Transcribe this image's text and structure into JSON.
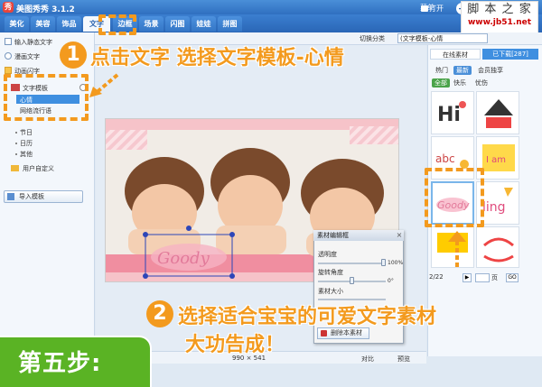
{
  "app": {
    "title": "美图秀秀 3.1.2",
    "logo_text": "秀"
  },
  "title_menu": "菜单",
  "tabs": [
    "美化",
    "美容",
    "饰品",
    "文字",
    "边框",
    "场景",
    "闪图",
    "娃娃",
    "拼图"
  ],
  "active_tab": "文字",
  "topbar": {
    "open_label": "打开"
  },
  "watermark": {
    "text": "脚 本 之 家",
    "url": "www.jb51.net"
  },
  "toolbar": {
    "category_label": "切换分类",
    "category_value": "(文字模板-心情"
  },
  "left_panel": {
    "items": [
      {
        "label": "输入静态文字"
      },
      {
        "label": "漫画文字"
      },
      {
        "label": "动画闪字"
      }
    ],
    "templates": {
      "header": "文字模板",
      "subs": [
        "心情",
        "网络流行语"
      ],
      "more": [
        "节日",
        "日历",
        "其他"
      ],
      "custom": "用户自定义"
    },
    "import_label": "导入模板"
  },
  "right_panel": {
    "tabs": [
      "在线素材",
      "已下载[287]"
    ],
    "pills": [
      "热门",
      "最新",
      "会员独享"
    ],
    "sub_tabs": [
      "全部",
      "快乐",
      "忧伤"
    ],
    "pager": {
      "current": "2/22",
      "of_label": "页",
      "go": "GO"
    },
    "footer": [
      "刷新",
      "下载本页",
      "素材"
    ]
  },
  "canvas": {
    "dims": "990 × 541",
    "compare": "对比",
    "preview": "预览"
  },
  "dialog": {
    "title": "素材编辑框",
    "opacity_label": "透明度",
    "opacity_value": "100%",
    "rotate_label": "旋转角度",
    "rotate_value": "0°",
    "size_label": "素材大小",
    "delete_label": "删除本素材"
  },
  "annotations": {
    "step1_num": "1",
    "step1_text": "点击文字 选择文字模板-心情",
    "step2_num": "2",
    "step2_line1": "选择适合宝宝的可爱文字素材",
    "step2_line2": "大功告成！",
    "step_badge": "第五步:"
  },
  "colors": {
    "accent": "#f39a1e",
    "blue": "#2f6fc0",
    "green": "#5ab324"
  }
}
